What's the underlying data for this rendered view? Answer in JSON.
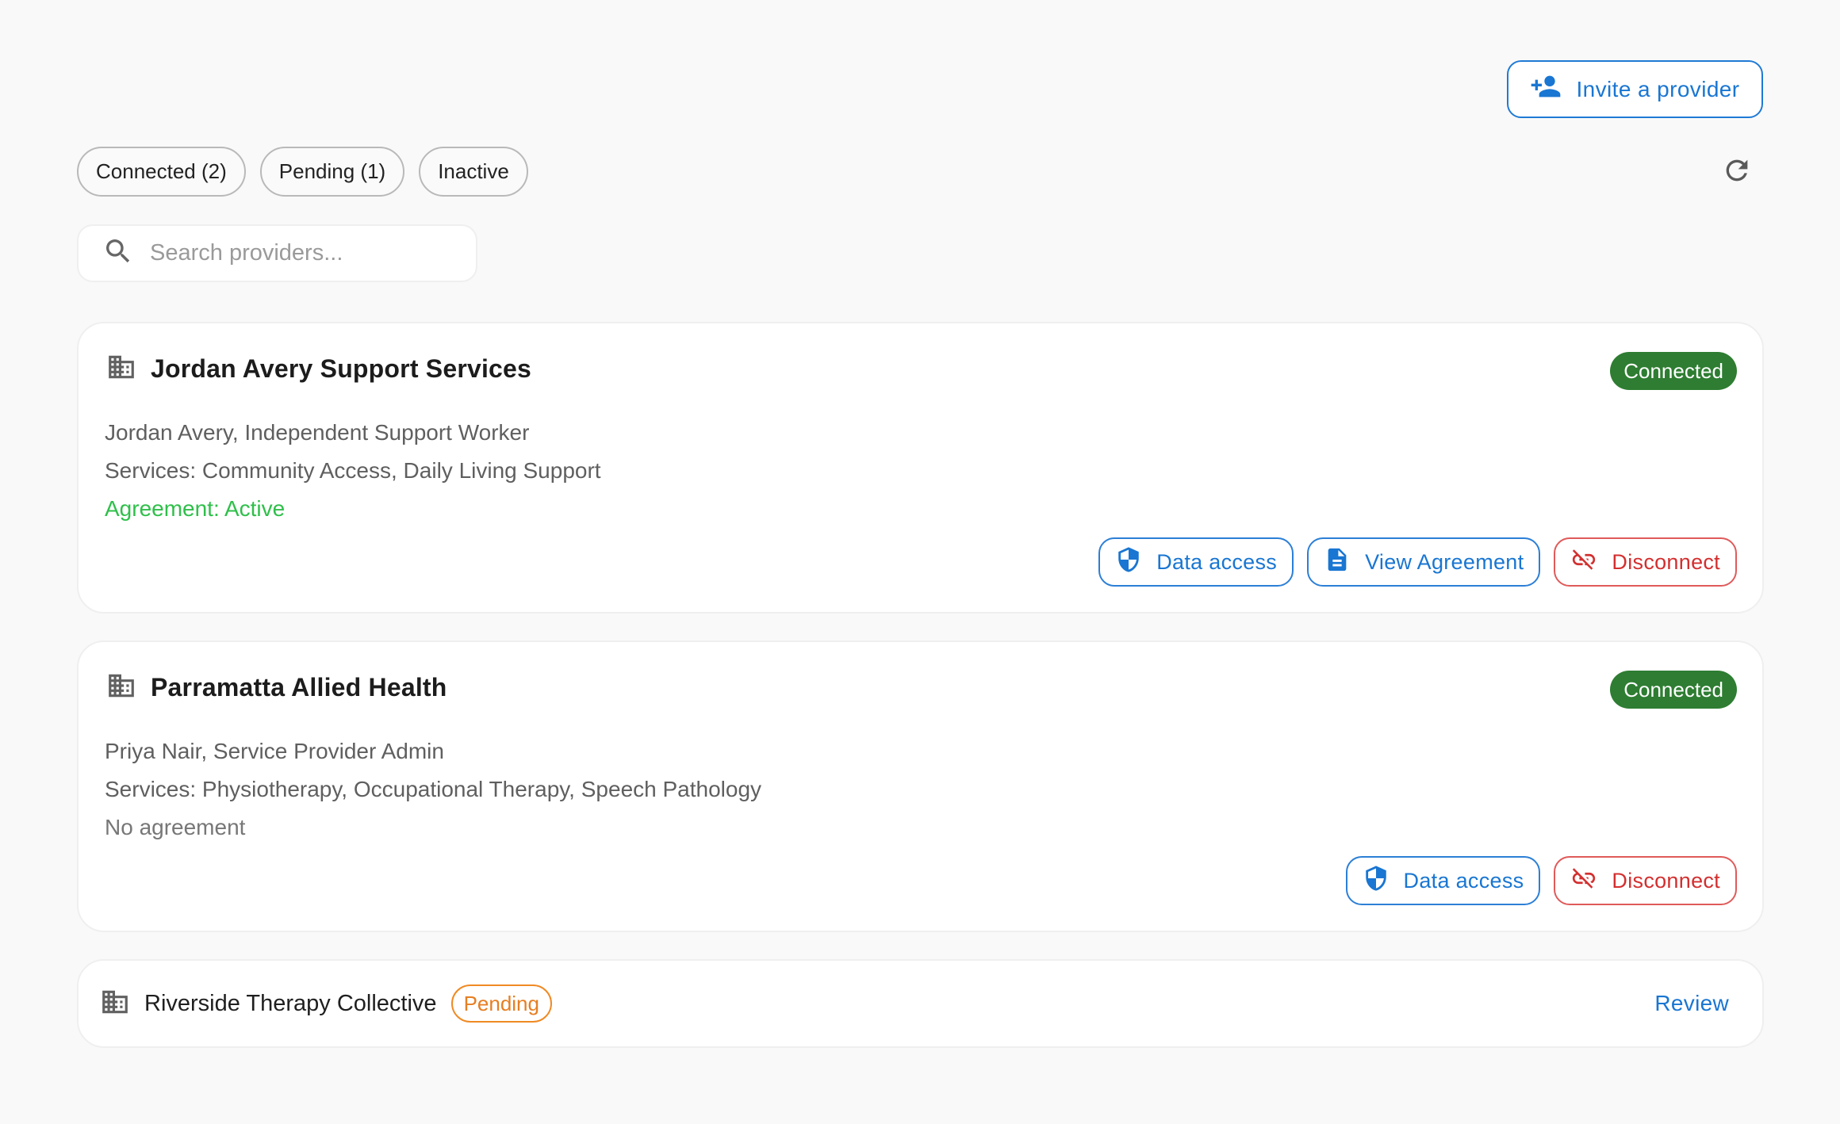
{
  "header": {
    "invite_label": "Invite a provider",
    "invite_icon": "person-add-icon"
  },
  "tabs": [
    {
      "label": "Connected (2)"
    },
    {
      "label": "Pending (1)"
    },
    {
      "label": "Inactive"
    }
  ],
  "search": {
    "placeholder": "Search providers..."
  },
  "colors": {
    "accent": "#1976d2",
    "connected": "#2e7d32",
    "active_agreement": "#2fbf4a",
    "danger": "#d32f2f",
    "pending": "#e67e22"
  },
  "providers": [
    {
      "name": "Jordan Avery Support Services",
      "status": "Connected",
      "contact": "Jordan Avery, Independent Support Worker",
      "services": "Services: Community Access, Daily Living Support",
      "agreement": "Agreement: Active",
      "actions": {
        "data_access": "Data access",
        "view_agreement": "View Agreement",
        "disconnect": "Disconnect"
      }
    },
    {
      "name": "Parramatta Allied Health",
      "status": "Connected",
      "contact": "Priya Nair, Service Provider Admin",
      "services": "Services: Physiotherapy, Occupational Therapy, Speech Pathology",
      "agreement": "No agreement",
      "actions": {
        "data_access": "Data access",
        "disconnect": "Disconnect"
      }
    },
    {
      "name": "Riverside Therapy Collective",
      "status": "Pending",
      "action": "Review"
    }
  ]
}
